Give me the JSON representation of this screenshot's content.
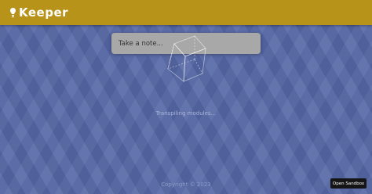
{
  "header": {
    "app_name": "Keeper",
    "logo_icon": "lightbulb-icon"
  },
  "note_form": {
    "placeholder": "Take a note..."
  },
  "loading": {
    "icon": "cube-spinner-icon",
    "text": "Transpiling modules..."
  },
  "footer": {
    "copyright": "Copyright © 2023"
  },
  "sandbox": {
    "button_label": "Open Sandbox"
  },
  "colors": {
    "header": "#b8931a",
    "background": "#5567a6",
    "note_field": "#a8a8a8",
    "sandbox_button": "#151515"
  }
}
